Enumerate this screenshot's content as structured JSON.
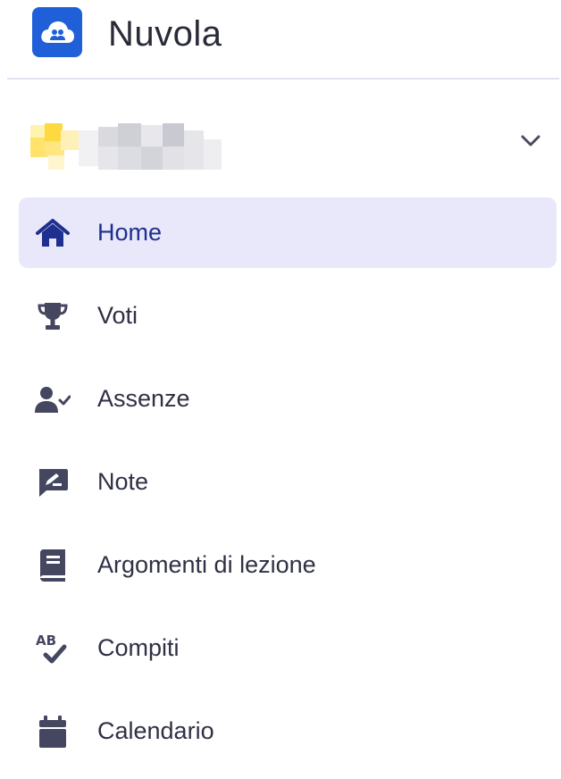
{
  "app": {
    "title": "Nuvola",
    "logo_icon": "cloud-users-icon",
    "brand_color": "#1f5fd8"
  },
  "account": {
    "name_redacted": true,
    "dropdown_icon": "chevron-down-icon"
  },
  "nav": {
    "active_color": "#1e2f8f",
    "active_background": "#e9e8fa",
    "items": [
      {
        "label": "Home",
        "icon": "home-icon",
        "active": true
      },
      {
        "label": "Voti",
        "icon": "trophy-icon",
        "active": false
      },
      {
        "label": "Assenze",
        "icon": "user-check-icon",
        "active": false
      },
      {
        "label": "Note",
        "icon": "note-edit-icon",
        "active": false
      },
      {
        "label": "Argomenti di lezione",
        "icon": "book-icon",
        "active": false
      },
      {
        "label": "Compiti",
        "icon": "spellcheck-icon",
        "active": false
      },
      {
        "label": "Calendario",
        "icon": "calendar-icon",
        "active": false
      }
    ]
  }
}
